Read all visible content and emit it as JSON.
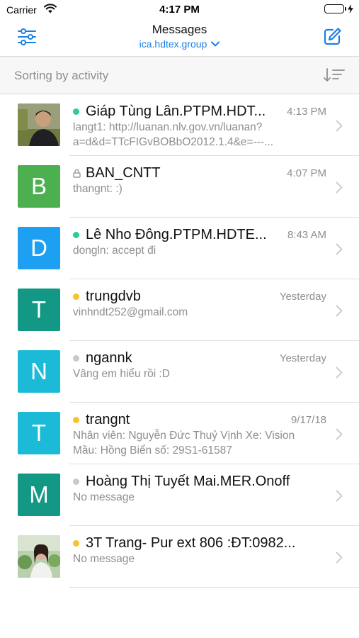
{
  "status_bar": {
    "carrier": "Carrier",
    "time": "4:17 PM"
  },
  "nav": {
    "title": "Messages",
    "subtitle": "ica.hdtex.group"
  },
  "sort": {
    "label": "Sorting by activity"
  },
  "colors": {
    "accent": "#1a7fe6",
    "online": "#2ecc8f",
    "away": "#f7c22b",
    "offline": "#c8c8c8",
    "green_avatar": "#4caf50",
    "blue_avatar": "#1ea0f2",
    "teal_avatar": "#129884",
    "cyan_avatar": "#1bbad6"
  },
  "conversations": [
    {
      "name": "Giáp Tùng Lân.PTPM.HDT...",
      "time": "4:13 PM",
      "preview": "langt1: http://luanan.nlv.gov.vn/luanan?a=d&d=TTcFIGvBOBbO2012.1.4&e=---...",
      "status": "online",
      "avatar_type": "photo"
    },
    {
      "name": "BAN_CNTT",
      "time": "4:07 PM",
      "preview": "thangnt: :)",
      "status": "locked",
      "avatar_letter": "B",
      "avatar_color": "#4caf50"
    },
    {
      "name": "Lê Nho Đông.PTPM.HDTE...",
      "time": "8:43 AM",
      "preview": "dongln: accept đi",
      "status": "online",
      "avatar_letter": "D",
      "avatar_color": "#1ea0f2"
    },
    {
      "name": "trungdvb",
      "time": "Yesterday",
      "preview": "vinhndt252@gmail.com",
      "status": "away",
      "avatar_letter": "T",
      "avatar_color": "#129884"
    },
    {
      "name": "ngannk",
      "time": "Yesterday",
      "preview": "Vâng em hiểu rồi :D",
      "status": "offline",
      "avatar_letter": "N",
      "avatar_color": "#1bbad6"
    },
    {
      "name": "trangnt",
      "time": "9/17/18",
      "preview": "Nhân viên: Nguyễn Đức Thuỷ Vịnh Xe: Vision  Mầu: Hồng  Biển số: 29S1-61587",
      "status": "away",
      "avatar_letter": "T",
      "avatar_color": "#1bbad6"
    },
    {
      "name": "Hoàng Thị Tuyết Mai.MER.Onoff",
      "time": "",
      "preview": "No message",
      "status": "offline",
      "avatar_letter": "M",
      "avatar_color": "#129884"
    },
    {
      "name": "3T Trang- Pur ext 806 :ĐT:0982...",
      "time": "",
      "preview": "No message",
      "status": "away",
      "avatar_type": "photo"
    }
  ]
}
